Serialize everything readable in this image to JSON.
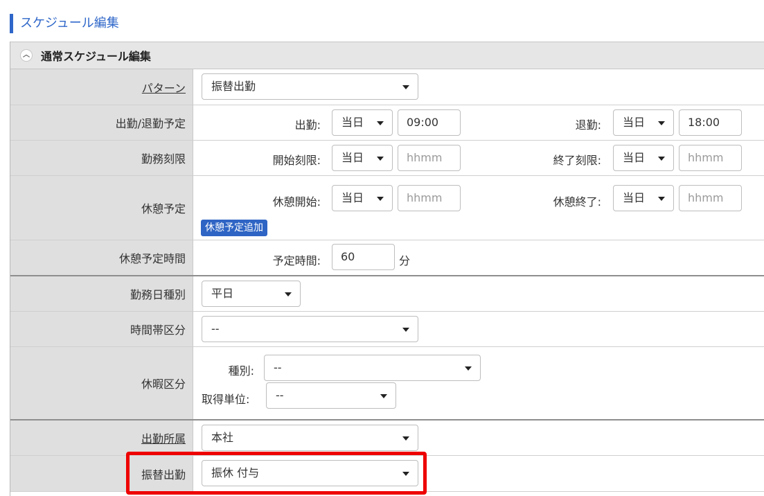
{
  "page_title": "スケジュール編集",
  "section": {
    "title": "通常スケジュール編集",
    "collapse_icon": "chevron-up-icon"
  },
  "pattern": {
    "label": "パターン",
    "value": "振替出勤"
  },
  "work_schedule": {
    "label": "出勤/退勤予定",
    "start_label": "出勤:",
    "start_day": "当日",
    "start_time": "09:00",
    "end_label": "退勤:",
    "end_day": "当日",
    "end_time": "18:00"
  },
  "work_limit": {
    "label": "勤務刻限",
    "start_label": "開始刻限:",
    "start_day": "当日",
    "start_placeholder": "hhmm",
    "end_label": "終了刻限:",
    "end_day": "当日",
    "end_placeholder": "hhmm"
  },
  "break_schedule": {
    "label": "休憩予定",
    "start_label": "休憩開始:",
    "start_day": "当日",
    "start_placeholder": "hhmm",
    "end_label": "休憩終了:",
    "end_day": "当日",
    "end_placeholder": "hhmm",
    "add_button": "休憩予定追加"
  },
  "break_time": {
    "label": "休憩予定時間",
    "field_label": "予定時間:",
    "value": "60",
    "unit": "分"
  },
  "workday_type": {
    "label": "勤務日種別",
    "value": "平日"
  },
  "time_zone_class": {
    "label": "時間帯区分",
    "value": "--"
  },
  "leave_class": {
    "label": "休暇区分",
    "type_label": "種別:",
    "type_value": "--",
    "unit_label": "取得単位:",
    "unit_value": "--"
  },
  "work_dept": {
    "label": "出勤所属",
    "value": "本社"
  },
  "substitute_work": {
    "label": "振替出勤",
    "value": "振休 付与"
  },
  "colors": {
    "accent": "#2f67c9",
    "highlight": "#ee0000",
    "label_bg": "#dfdfdf"
  }
}
